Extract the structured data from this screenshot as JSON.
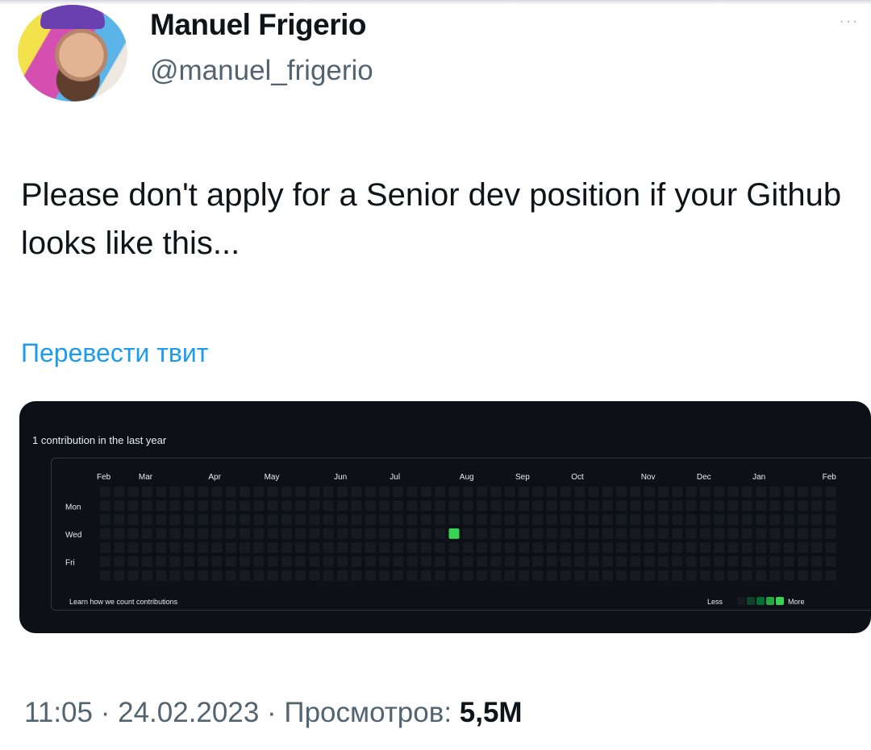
{
  "author": {
    "display_name": "Manuel Frigerio",
    "handle": "@manuel_frigerio"
  },
  "tweet": {
    "text": "Please don't apply for a Senior dev position if your Github looks like this...",
    "translate_label": "Перевести твит"
  },
  "contribution_card": {
    "summary": "1 contribution in the last year",
    "months": [
      "Feb",
      "Mar",
      "Apr",
      "May",
      "Jun",
      "Jul",
      "Aug",
      "Sep",
      "Oct",
      "Nov",
      "Dec",
      "Jan",
      "Feb"
    ],
    "weekday_labels": [
      "Mon",
      "Wed",
      "Fri"
    ],
    "learn_link": "Learn how we count contributions",
    "legend_less": "Less",
    "legend_more": "More",
    "weeks": 53,
    "days": 7,
    "contributions": [
      {
        "week": 25,
        "day": 3,
        "level": 4
      }
    ],
    "colors": {
      "empty": "#161b22",
      "level1": "#0e4429",
      "level2": "#006d32",
      "level3": "#26a641",
      "level4": "#39d353"
    }
  },
  "meta": {
    "time": "11:05",
    "date": "24.02.2023",
    "views_label": "Просмотров:",
    "views_count": "5,5M"
  },
  "icons": {
    "more": "more-options-icon"
  }
}
